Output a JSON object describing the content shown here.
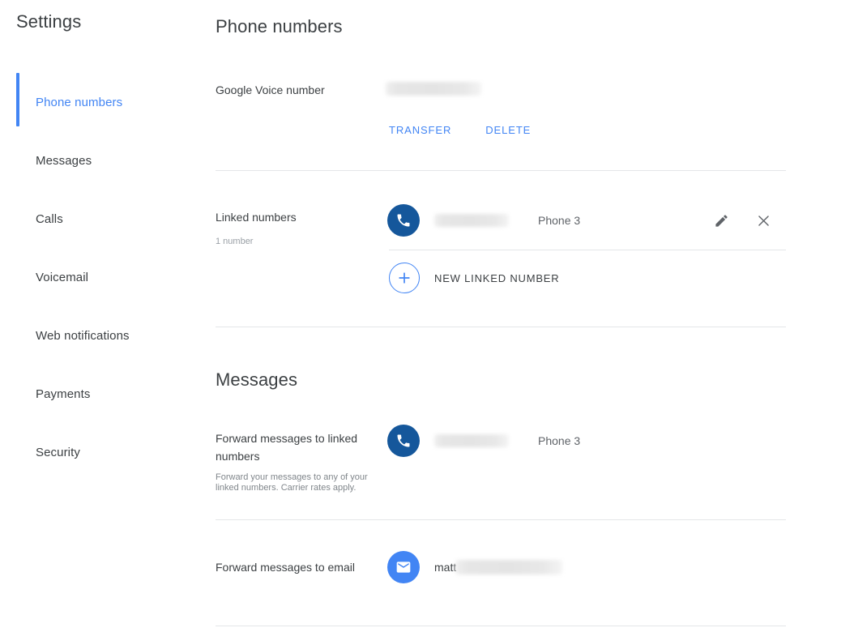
{
  "sidebar": {
    "title": "Settings",
    "items": [
      {
        "label": "Phone numbers",
        "active": true
      },
      {
        "label": "Messages",
        "active": false
      },
      {
        "label": "Calls",
        "active": false
      },
      {
        "label": "Voicemail",
        "active": false
      },
      {
        "label": "Web notifications",
        "active": false
      },
      {
        "label": "Payments",
        "active": false
      },
      {
        "label": "Security",
        "active": false
      }
    ]
  },
  "colors": {
    "accent": "#4285f4",
    "phone_icon_bg": "#15579b",
    "mail_icon_bg": "#4285f4",
    "text_primary": "#3c4043",
    "text_secondary": "#5f6368",
    "divider": "#e4e6e8"
  },
  "phone_numbers": {
    "heading": "Phone numbers",
    "google_voice": {
      "label": "Google Voice number",
      "value": "",
      "value_redacted": true,
      "actions": [
        {
          "label": "TRANSFER",
          "name": "transfer-button"
        },
        {
          "label": "DELETE",
          "name": "delete-button"
        }
      ]
    },
    "linked_numbers": {
      "label": "Linked numbers",
      "count_text": "1 number",
      "entries": [
        {
          "icon": "phone-icon",
          "number": "",
          "number_redacted": true,
          "name": "Phone 3",
          "edit_icon": "pencil-icon",
          "remove_icon": "close-icon"
        }
      ],
      "add_button": {
        "icon": "plus-icon",
        "label": "NEW LINKED NUMBER"
      }
    }
  },
  "messages": {
    "heading": "Messages",
    "forward_to_linked": {
      "label": "Forward messages to linked numbers",
      "description": "Forward your messages to any of your linked numbers. Carrier rates apply.",
      "icon": "phone-icon",
      "number": "",
      "number_redacted": true,
      "name": "Phone 3",
      "control": "checkbox",
      "checked": false
    },
    "forward_to_email": {
      "label": "Forward messages to email",
      "icon": "mail-icon",
      "email_visible": "matt",
      "email_redacted": true,
      "control": "toggle",
      "enabled": true
    }
  }
}
